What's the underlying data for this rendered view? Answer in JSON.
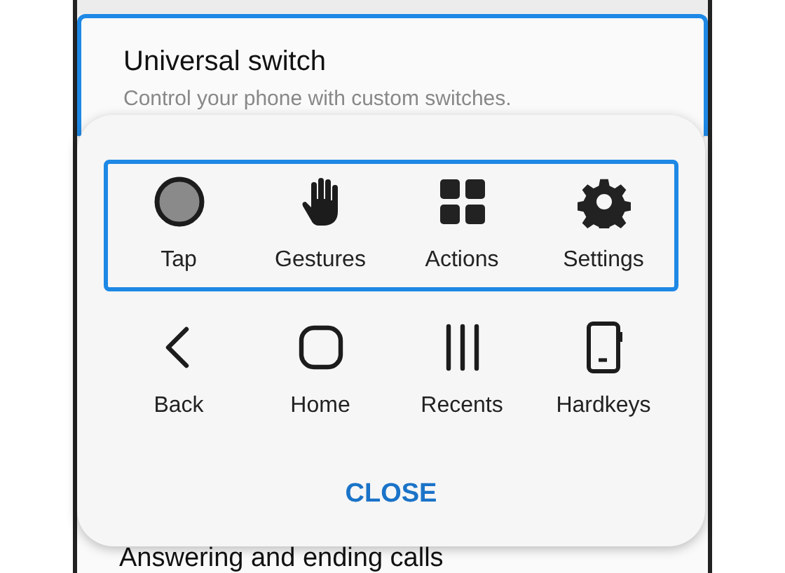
{
  "setting": {
    "title": "Universal switch",
    "subtitle": "Control your phone with custom switches.",
    "selected": true
  },
  "next_setting": {
    "title": "Answering and ending calls"
  },
  "menu": {
    "groups": [
      {
        "selected": true,
        "items": [
          {
            "kind": "tap",
            "label": "Tap"
          },
          {
            "kind": "hand",
            "label": "Gestures"
          },
          {
            "kind": "grid",
            "label": "Actions"
          },
          {
            "kind": "gear",
            "label": "Settings"
          }
        ]
      },
      {
        "selected": false,
        "items": [
          {
            "kind": "back",
            "label": "Back"
          },
          {
            "kind": "home",
            "label": "Home"
          },
          {
            "kind": "recents",
            "label": "Recents"
          },
          {
            "kind": "phone",
            "label": "Hardkeys"
          }
        ]
      }
    ],
    "close": "CLOSE"
  }
}
